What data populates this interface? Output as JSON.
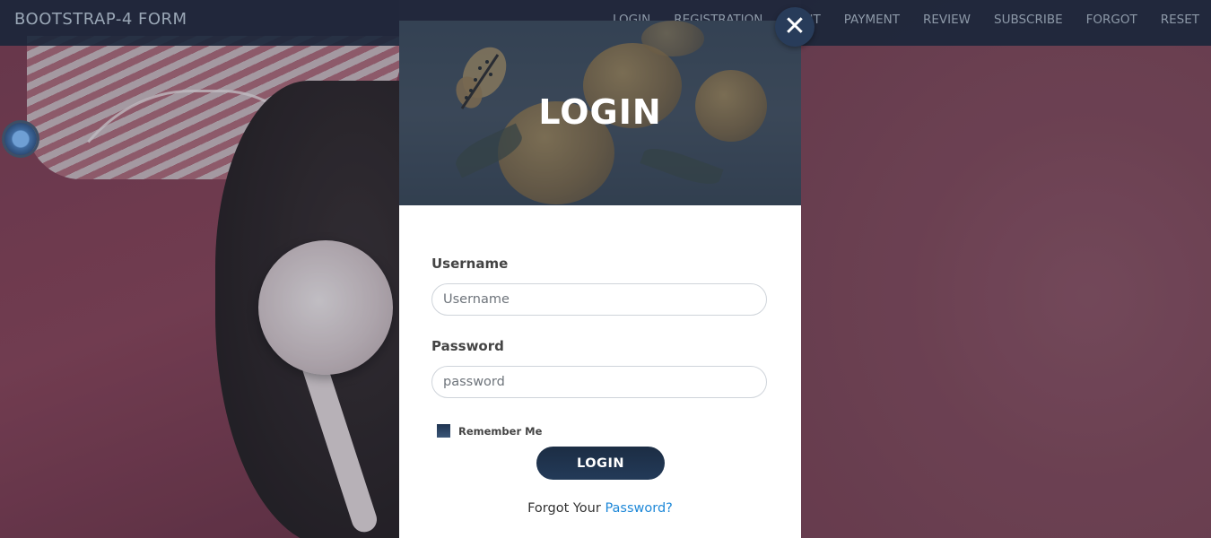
{
  "navbar": {
    "brand": "BOOTSTRAP-4 FORM",
    "links": [
      "LOGIN",
      "REGISTRATION",
      "CONT",
      "PAYMENT",
      "REVIEW",
      "SUBSCRIBE",
      "FORGOT",
      "RESET"
    ]
  },
  "modal": {
    "title": "LOGIN",
    "close_icon": "close-icon",
    "username": {
      "label": "Username",
      "placeholder": "Username",
      "value": ""
    },
    "password": {
      "label": "Password",
      "placeholder": "password",
      "value": ""
    },
    "remember_label": "Remember Me",
    "login_button": "LOGIN",
    "forgot_text": "Forgot Your",
    "forgot_link": "Password?"
  },
  "icons": {
    "settings": "gear-icon",
    "close": "close-icon",
    "decoration": "butterfly-icon"
  },
  "colors": {
    "navbar_bg": "#19263a",
    "button_bg": "#1c2d44",
    "link": "#1e88d8",
    "background": "#8a4a5c"
  }
}
